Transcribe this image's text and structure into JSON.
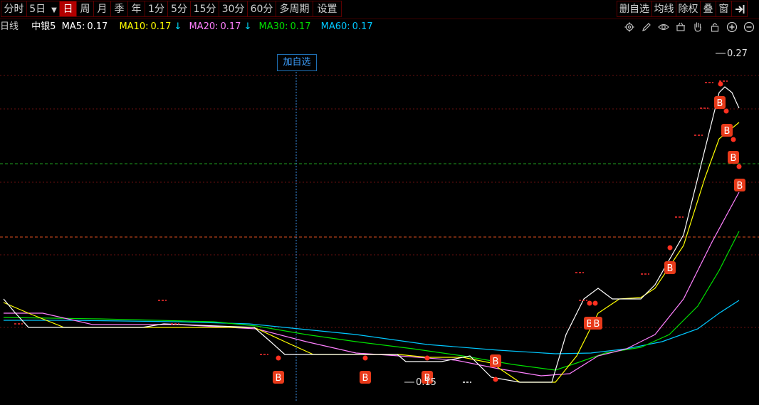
{
  "toolbar": {
    "left_items": [
      "分时",
      "5日",
      "日",
      "周",
      "月",
      "季",
      "年",
      "1分",
      "5分",
      "15分",
      "30分",
      "60分",
      "多周期",
      "设置"
    ],
    "active_item": "日",
    "right_items": [
      "删自选",
      "均线",
      "除权",
      "叠",
      "窗"
    ],
    "exit_icon": "exit-arrow-icon"
  },
  "infobar": {
    "period": "日线",
    "stock": "中银5",
    "ma5_label": "MA5:",
    "ma5_value": "0.17",
    "ma10_label": "MA10:",
    "ma10_value": "0.17",
    "ma10_arrow": "↓",
    "ma20_label": "MA20:",
    "ma20_value": "0.17",
    "ma20_arrow": "↓",
    "ma30_label": "MA30:",
    "ma30_value": "0.17",
    "ma60_label": "MA60:",
    "ma60_value": "0.17",
    "colors": {
      "ma5": "#ffffff",
      "ma10": "#ffff00",
      "ma20": "#ff80ff",
      "ma30": "#00e000",
      "ma60": "#00c8ff"
    }
  },
  "icons": [
    "settings-icon",
    "pen-icon",
    "eye-icon",
    "basket-icon",
    "hand-icon",
    "lock-icon",
    "zoom-in-icon",
    "zoom-out-icon"
  ],
  "crosshair": {
    "button_label": "加自选"
  },
  "labels": {
    "max_label": "0.27",
    "min_label": "0.15",
    "arrow": "←"
  },
  "signal_text": "B",
  "chart_data": {
    "type": "line",
    "title": "",
    "signals": 12
  }
}
